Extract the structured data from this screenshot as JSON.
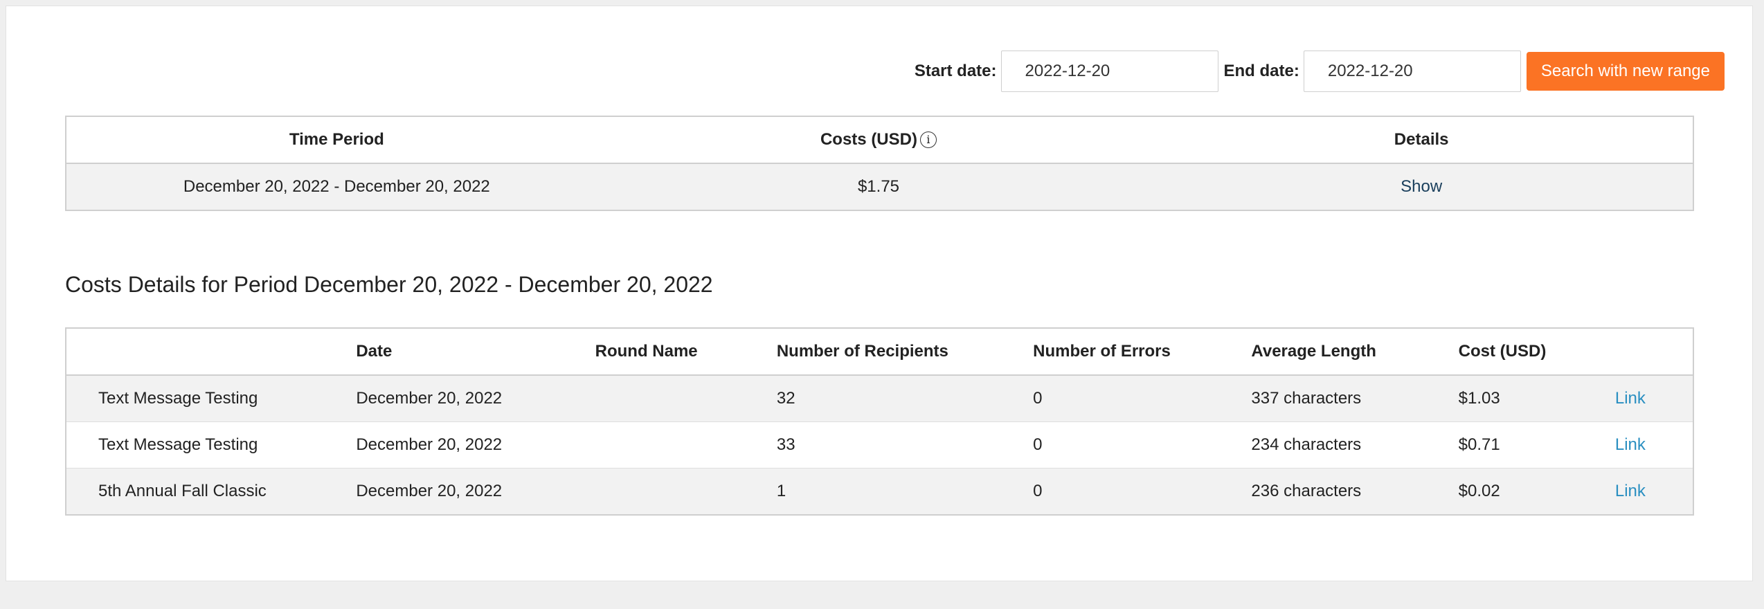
{
  "range": {
    "start_label": "Start date:",
    "start_value": "2022-12-20",
    "end_label": "End date:",
    "end_value": "2022-12-20",
    "search_label": "Search with new range",
    "accent_color": "#fb7324"
  },
  "summary": {
    "headers": {
      "time_period": "Time Period",
      "costs": "Costs (USD)",
      "details": "Details"
    },
    "info_icon": "info-icon",
    "row": {
      "period": "December 20, 2022 - December 20, 2022",
      "cost": "$1.75",
      "action": "Show"
    }
  },
  "details": {
    "title": "Costs Details for Period December 20, 2022 - December 20, 2022",
    "headers": {
      "name": "",
      "date": "Date",
      "round": "Round Name",
      "recipients": "Number of Recipients",
      "errors": "Number of Errors",
      "length": "Average Length",
      "cost": "Cost (USD)",
      "link": ""
    },
    "rows": [
      {
        "name": "Text Message Testing",
        "date": "December 20, 2022",
        "round": "",
        "recipients": "32",
        "errors": "0",
        "length": "337 characters",
        "cost": "$1.03",
        "link": "Link"
      },
      {
        "name": "Text Message Testing",
        "date": "December 20, 2022",
        "round": "",
        "recipients": "33",
        "errors": "0",
        "length": "234 characters",
        "cost": "$0.71",
        "link": "Link"
      },
      {
        "name": "5th Annual Fall Classic",
        "date": "December 20, 2022",
        "round": "",
        "recipients": "1",
        "errors": "0",
        "length": "236 characters",
        "cost": "$0.02",
        "link": "Link"
      }
    ]
  }
}
